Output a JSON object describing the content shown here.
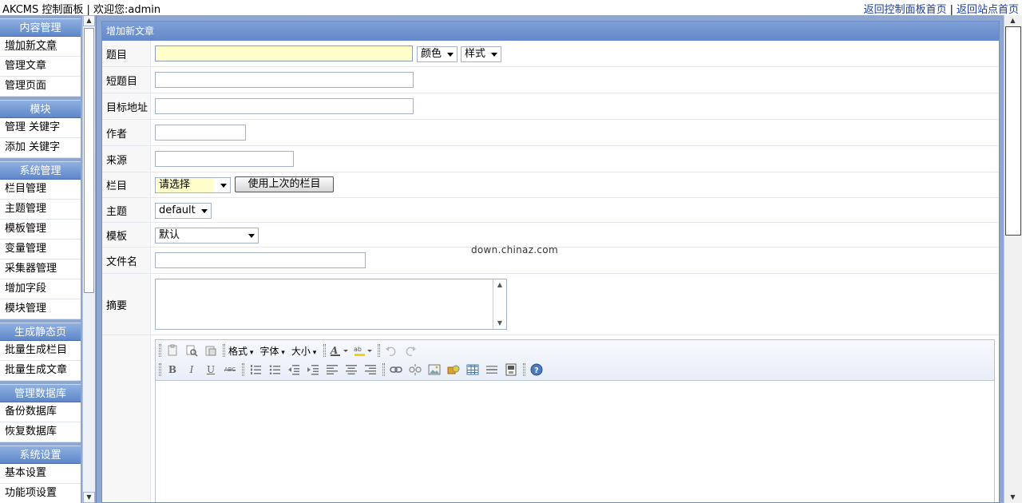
{
  "topbar": {
    "title": "AKCMS 控制面板 | 欢迎您:admin",
    "link_home": "返回控制面板首页",
    "separator": "|",
    "link_site": "返回站点首页"
  },
  "sidebar": {
    "groups": [
      {
        "title": "内容管理",
        "items": [
          "增加新文章",
          "管理文章",
          "管理页面"
        ]
      },
      {
        "title": "模块",
        "items": [
          "管理 关键字",
          "添加 关键字"
        ]
      },
      {
        "title": "系统管理",
        "items": [
          "栏目管理",
          "主题管理",
          "模板管理",
          "变量管理",
          "采集器管理",
          "增加字段",
          "模块管理"
        ]
      },
      {
        "title": "生成静态页",
        "items": [
          "批量生成栏目",
          "批量生成文章"
        ]
      },
      {
        "title": "管理数据库",
        "items": [
          "备份数据库",
          "恢复数据库"
        ]
      },
      {
        "title": "系统设置",
        "items": [
          "基本设置",
          "功能项设置"
        ]
      }
    ]
  },
  "panel": {
    "header": "增加新文章",
    "fields": {
      "title_label": "题目",
      "title_value": "",
      "color_select": "颜色",
      "style_select": "样式",
      "short_title_label": "短题目",
      "target_url_label": "目标地址",
      "author_label": "作者",
      "source_label": "来源",
      "category_label": "栏目",
      "category_select": "请选择",
      "use_last_category_button": "使用上次的栏目",
      "theme_label": "主题",
      "theme_select": "default",
      "template_label": "模板",
      "template_select": "默认",
      "filename_label": "文件名",
      "summary_label": "摘要"
    },
    "editor": {
      "format_dropdown": "格式",
      "font_dropdown": "字体",
      "size_dropdown": "大小",
      "icons_row1": [
        "paste-icon",
        "find-icon",
        "paste-word-icon",
        "font-color-icon",
        "highlight-icon",
        "undo-icon",
        "redo-icon"
      ],
      "icons_row2": [
        "bold-icon",
        "italic-icon",
        "underline-icon",
        "strikethrough-icon",
        "ordered-list-icon",
        "unordered-list-icon",
        "outdent-icon",
        "indent-icon",
        "align-left-icon",
        "align-center-icon",
        "align-right-icon",
        "link-icon",
        "unlink-icon",
        "image-icon",
        "media-icon",
        "table-icon",
        "horizontal-rule-icon",
        "source-icon",
        "help-icon"
      ]
    }
  },
  "watermark": "down.chinaz.com",
  "colors": {
    "frame_bg": "#8ea7d0",
    "header_gradient_top": "#8fb0e0",
    "header_gradient_bottom": "#5f87c9",
    "link_color": "#1c3f94",
    "title_input_bg": "#ffffcc"
  }
}
